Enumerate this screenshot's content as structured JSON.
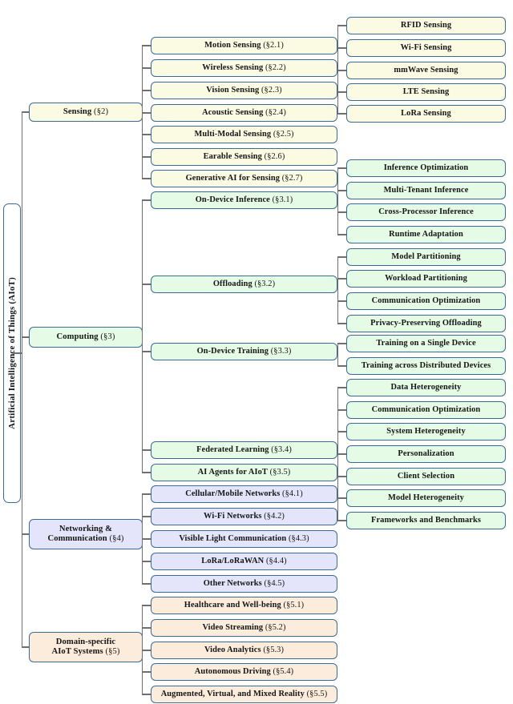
{
  "figure": {
    "root": {
      "label": "Artificial Intelligence of Things (AIoT)"
    },
    "top_cropped_text": "",
    "colors": {
      "border": "#3b6a97",
      "line": "#6f6f6f",
      "sensing_fill": "#fbfbe4",
      "computing_fill": "#e6fbe6",
      "networking_fill": "#e4e4fb",
      "domain_fill": "#fcecdc"
    },
    "branches": [
      {
        "id": "sensing",
        "title": "Sensing",
        "section": "(§2)",
        "fill": "cream",
        "children": [
          {
            "title": "Motion Sensing",
            "section": "(§2.1)",
            "grandchildren": []
          },
          {
            "title": "Wireless Sensing",
            "section": "(§2.2)",
            "grandchildren": [
              {
                "title": "RFID Sensing",
                "section": ""
              },
              {
                "title": "Wi-Fi Sensing",
                "section": ""
              },
              {
                "title": "mmWave Sensing",
                "section": ""
              },
              {
                "title": "LTE Sensing",
                "section": ""
              },
              {
                "title": "LoRa Sensing",
                "section": ""
              }
            ]
          },
          {
            "title": "Vision Sensing",
            "section": "(§2.3)",
            "grandchildren": []
          },
          {
            "title": "Acoustic Sensing",
            "section": "(§2.4)",
            "grandchildren": []
          },
          {
            "title": "Multi-Modal Sensing",
            "section": "(§2.5)",
            "grandchildren": []
          },
          {
            "title": "Earable Sensing",
            "section": "(§2.6)",
            "grandchildren": []
          },
          {
            "title": "Generative AI for Sensing",
            "section": "(§2.7)",
            "grandchildren": []
          }
        ]
      },
      {
        "id": "computing",
        "title": "Computing",
        "section": "(§3)",
        "fill": "green",
        "children": [
          {
            "title": "On-Device Inference",
            "section": "(§3.1)",
            "grandchildren": [
              {
                "title": "Inference Optimization",
                "section": ""
              },
              {
                "title": "Multi-Tenant Inference",
                "section": ""
              },
              {
                "title": "Cross-Processor Inference",
                "section": ""
              },
              {
                "title": "Runtime Adaptation",
                "section": ""
              }
            ]
          },
          {
            "title": "Offloading",
            "section": "(§3.2)",
            "grandchildren": [
              {
                "title": "Model Partitioning",
                "section": ""
              },
              {
                "title": "Workload Partitioning",
                "section": ""
              },
              {
                "title": "Communication Optimization",
                "section": ""
              },
              {
                "title": "Privacy-Preserving Offloading",
                "section": ""
              }
            ]
          },
          {
            "title": "On-Device Training",
            "section": "(§3.3)",
            "grandchildren": [
              {
                "title": "Training on a Single Device",
                "section": ""
              },
              {
                "title": "Training across Distributed Devices",
                "section": ""
              }
            ]
          },
          {
            "title": "Federated Learning",
            "section": "(§3.4)",
            "grandchildren": [
              {
                "title": "Data Heterogeneity",
                "section": ""
              },
              {
                "title": "Communication Optimization",
                "section": ""
              },
              {
                "title": "System Heterogeneity",
                "section": ""
              },
              {
                "title": "Personalization",
                "section": ""
              },
              {
                "title": "Client Selection",
                "section": ""
              },
              {
                "title": "Model Heterogeneity",
                "section": ""
              },
              {
                "title": "Frameworks and Benchmarks",
                "section": ""
              }
            ]
          },
          {
            "title": "AI Agents for AIoT",
            "section": "(§3.5)",
            "grandchildren": []
          }
        ]
      },
      {
        "id": "networking",
        "title": "Networking &",
        "title2": "Communication",
        "section": "(§4)",
        "fill": "lilac",
        "children": [
          {
            "title": "Cellular/Mobile Networks",
            "section": "(§4.1)",
            "grandchildren": []
          },
          {
            "title": "Wi-Fi Networks",
            "section": "(§4.2)",
            "grandchildren": []
          },
          {
            "title": "Visible Light Communication",
            "section": "(§4.3)",
            "grandchildren": []
          },
          {
            "title": "LoRa/LoRaWAN",
            "section": "(§4.4)",
            "grandchildren": []
          },
          {
            "title": "Other Networks",
            "section": "(§4.5)",
            "grandchildren": []
          }
        ]
      },
      {
        "id": "domain",
        "title": "Domain-specific",
        "title2": "AIoT Systems",
        "section": "(§5)",
        "fill": "peach",
        "children": [
          {
            "title": "Healthcare and Well-being",
            "section": "(§5.1)",
            "grandchildren": []
          },
          {
            "title": "Video Streaming",
            "section": "(§5.2)",
            "grandchildren": []
          },
          {
            "title": "Video Analytics",
            "section": "(§5.3)",
            "grandchildren": []
          },
          {
            "title": "Autonomous Driving",
            "section": "(§5.4)",
            "grandchildren": []
          },
          {
            "title": "Augmented, Virtual, and Mixed Reality",
            "section": "(§5.5)",
            "grandchildren": []
          }
        ]
      }
    ]
  }
}
